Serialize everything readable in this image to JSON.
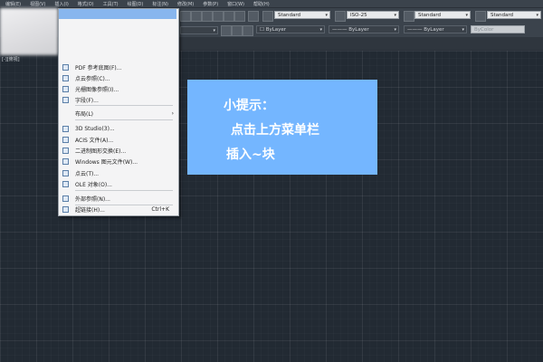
{
  "menubar": {
    "items": [
      "编辑(E)",
      "视图(V)",
      "插入(I)",
      "格式(O)",
      "工具(T)",
      "绘图(D)",
      "标注(N)",
      "修改(M)",
      "参数(P)",
      "窗口(W)",
      "帮助(H)"
    ]
  },
  "toolbar": {
    "text_style": "Standard",
    "dim_style": "ISO-25",
    "table_style": "Standard",
    "multileader_style": "Standard",
    "layer_color": "ByLayer",
    "linetype": "ByLayer",
    "lineweight": "ByLayer",
    "plot_style": "ByLayer",
    "plot_color": "ByColor"
  },
  "left_label": "[-][俯视]",
  "insert_menu": {
    "items": [
      {
        "label": "PDF 参考底图(F)...",
        "icon": "pdf-underlay-icon"
      },
      {
        "label": "点云参照(C)...",
        "icon": "point-cloud-icon"
      },
      {
        "label": "光栅图像参照(I)...",
        "icon": "raster-image-icon"
      },
      {
        "label": "字段(F)...",
        "icon": "field-icon"
      },
      {
        "label": "布局(L)",
        "icon": "",
        "submenu": "›"
      },
      {
        "label": "3D Studio(3)...",
        "icon": "3d-studio-icon"
      },
      {
        "label": "ACIS 文件(A)...",
        "icon": "acis-file-icon"
      },
      {
        "label": "二进制图形交换(E)...",
        "icon": "dxb-icon"
      },
      {
        "label": "Windows 图元文件(W)...",
        "icon": "wmf-icon"
      },
      {
        "label": "点云(T)...",
        "icon": "point-cloud-attach-icon"
      },
      {
        "label": "OLE 对象(O)...",
        "icon": "ole-object-icon"
      },
      {
        "label": "外部参照(N)...",
        "icon": "external-reference-icon"
      },
      {
        "label": "超链接(H)...",
        "icon": "hyperlink-icon",
        "shortcut": "Ctrl+K"
      }
    ]
  },
  "tip": {
    "line1": "小提示：",
    "line2": "点击上方菜单栏",
    "line3": "插入~块"
  },
  "colors": {
    "canvas": "#222a33",
    "tip_box": "#74b6ff",
    "menu_highlight": "#88b6ee"
  }
}
